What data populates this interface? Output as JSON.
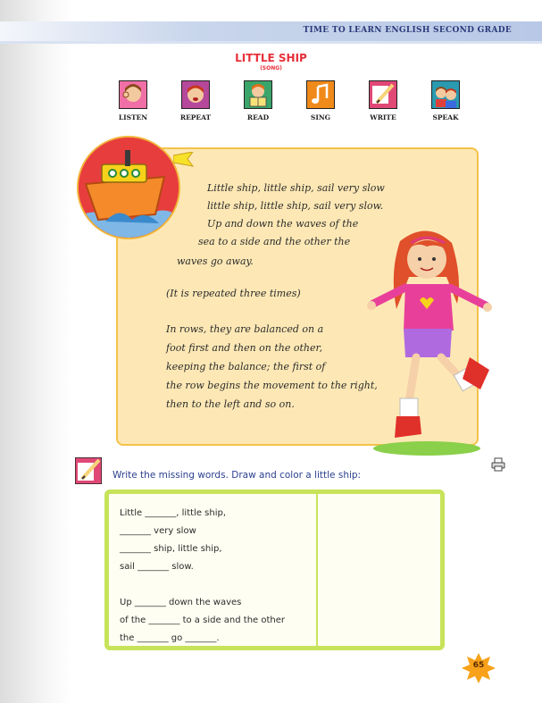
{
  "header": {
    "book_title": "TIME TO LEARN ENGLISH SECOND GRADE"
  },
  "lesson": {
    "title": "LITTLE SHIP",
    "subtitle": "(SONG)"
  },
  "activity_icons": [
    {
      "label": "LISTEN",
      "icon": "listen-icon",
      "color": "#f06fa6"
    },
    {
      "label": "REPEAT",
      "icon": "repeat-icon",
      "color": "#b5489a"
    },
    {
      "label": "READ",
      "icon": "read-icon",
      "color": "#3aa56a"
    },
    {
      "label": "SING",
      "icon": "sing-icon",
      "color": "#f08a1a"
    },
    {
      "label": "WRITE",
      "icon": "write-icon",
      "color": "#e04876"
    },
    {
      "label": "SPEAK",
      "icon": "speak-icon",
      "color": "#2a9ab0"
    }
  ],
  "song": {
    "lines": [
      "Little ship, little ship, sail very slow",
      "little ship, little ship, sail very slow.",
      "Up and down the waves of the",
      "sea to a side and the other the",
      "waves go away.",
      "(It is repeated three times)",
      "In rows, they are balanced on a",
      "foot first and then on the other,",
      "keeping the balance; the first of",
      "the row begins the movement to the right,",
      "then to the left and so on."
    ]
  },
  "exercise": {
    "instruction": "Write the missing words. Draw and color a little ship:",
    "lines": [
      "Little _______, little ship,",
      "_______ very slow",
      "_______ ship, little ship,",
      "sail _______ slow.",
      "Up _______ down the waves",
      "of the _______ to a side and the other",
      "the _______ go _______."
    ]
  },
  "page": {
    "number": "65"
  },
  "colors": {
    "title_red": "#e8303a",
    "song_box_bg": "#fde8b5",
    "exercise_border": "#c7e35a",
    "instruction_blue": "#2a3f8f"
  }
}
